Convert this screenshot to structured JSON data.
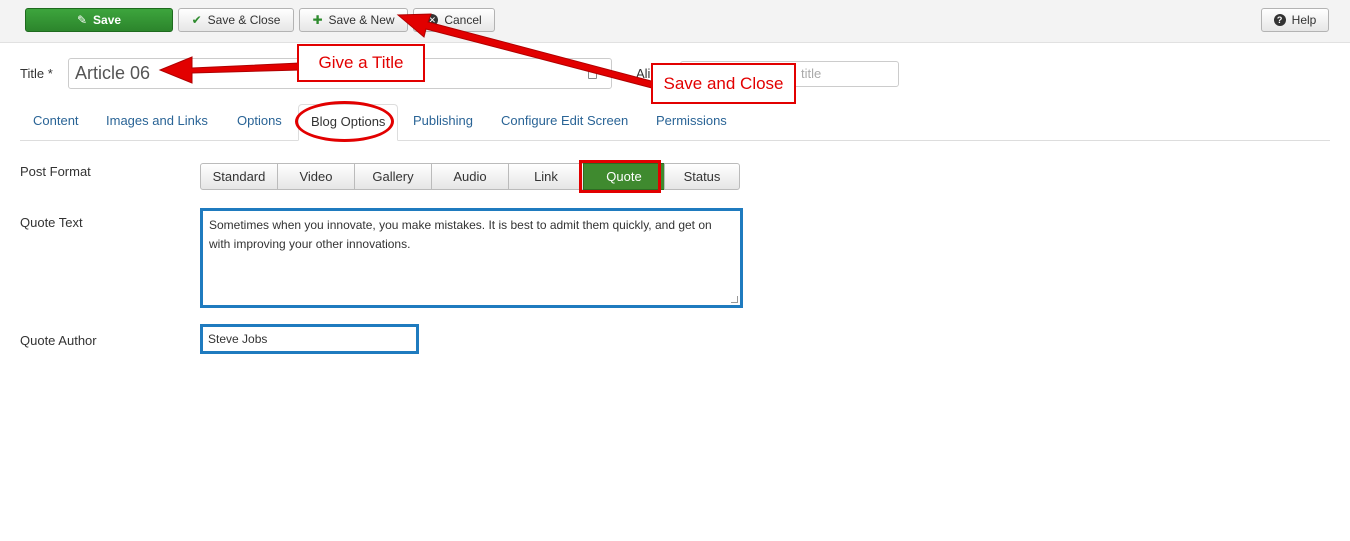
{
  "toolbar": {
    "save_label": "Save",
    "save_close_label": "Save & Close",
    "save_new_label": "Save & New",
    "cancel_label": "Cancel",
    "help_label": "Help"
  },
  "form": {
    "title_label": "Title *",
    "title_value": "Article 06",
    "alias_label": "Ali",
    "alias_placeholder": "title"
  },
  "tabs": [
    {
      "label": "Content"
    },
    {
      "label": "Images and Links"
    },
    {
      "label": "Options"
    },
    {
      "label": "Blog Options",
      "active": true
    },
    {
      "label": "Publishing"
    },
    {
      "label": "Configure Edit Screen"
    },
    {
      "label": "Permissions"
    }
  ],
  "blog_options": {
    "post_format_label": "Post Format",
    "formats": [
      "Standard",
      "Video",
      "Gallery",
      "Audio",
      "Link",
      "Quote",
      "Status"
    ],
    "selected_format": "Quote",
    "quote_text_label": "Quote Text",
    "quote_text_value": "Sometimes when you innovate, you make mistakes. It is best to admit them quickly, and get on with improving your other innovations.",
    "quote_author_label": "Quote Author",
    "quote_author_value": "Steve Jobs"
  },
  "annotations": {
    "give_title": "Give a Title",
    "save_and_close": "Save and Close"
  },
  "colors": {
    "save_green": "#2c852c",
    "active_format_green": "#3f8a2f",
    "annotation_red": "#e20000",
    "highlight_blue": "#1f7bbf",
    "link_blue": "#2a6496"
  }
}
